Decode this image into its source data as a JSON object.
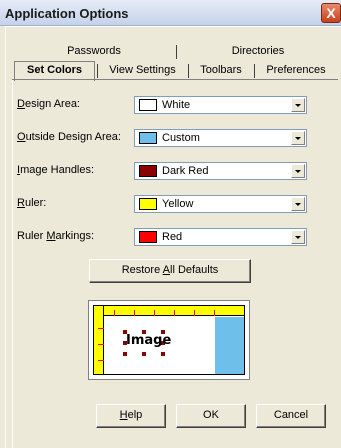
{
  "window": {
    "title": "Application Options",
    "close_glyph": "X"
  },
  "tabs": {
    "row1": [
      {
        "label": "Passwords"
      },
      {
        "label": "Directories"
      }
    ],
    "row2": [
      {
        "label": "Set Colors",
        "active": true
      },
      {
        "label": "View Settings"
      },
      {
        "label": "Toolbars"
      },
      {
        "label": "Preferences"
      }
    ]
  },
  "settings": [
    {
      "label_prefix": "",
      "label_u": "D",
      "label_rest": "esign Area:",
      "value": "White",
      "color": "#ffffff"
    },
    {
      "label_prefix": "",
      "label_u": "O",
      "label_rest": "utside Design Area:",
      "value": "Custom",
      "color": "#6ec0ea"
    },
    {
      "label_prefix": "",
      "label_u": "I",
      "label_rest": "mage Handles:",
      "value": "Dark Red",
      "color": "#8b0000"
    },
    {
      "label_prefix": "",
      "label_u": "R",
      "label_rest": "uler:",
      "value": "Yellow",
      "color": "#ffff00"
    },
    {
      "label_prefix": "Ruler ",
      "label_u": "M",
      "label_rest": "arkings:",
      "value": "Red",
      "color": "#ff0000"
    }
  ],
  "restore_button": {
    "prefix": "Restore ",
    "underlined": "A",
    "rest": "ll Defaults"
  },
  "preview": {
    "image_label": "Image"
  },
  "footer": {
    "help": {
      "underlined": "H",
      "rest": "elp"
    },
    "ok": "OK",
    "cancel": "Cancel"
  }
}
